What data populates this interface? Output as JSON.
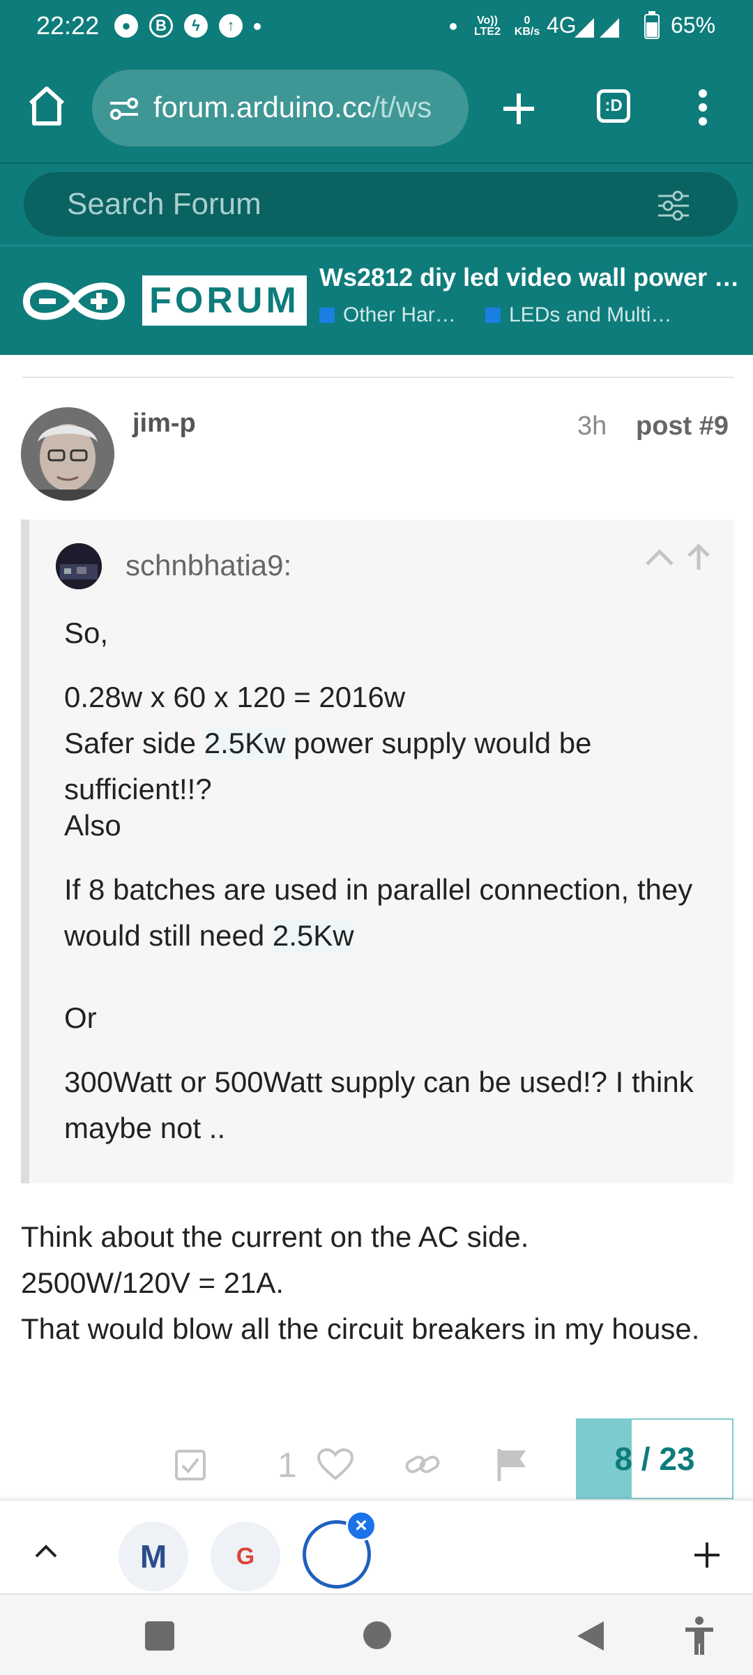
{
  "status_bar": {
    "time": "22:22",
    "notif_icons": [
      "chat-bubble-icon",
      "b-icon",
      "messenger-icon",
      "upload-icon"
    ],
    "net_label_1": "Vo))",
    "net_label_2": "LTE2",
    "speed_value": "0",
    "speed_unit": "KB/s",
    "network": "4G",
    "battery": "65%"
  },
  "browser": {
    "url_host": "forum.arduino.cc",
    "url_path": "/t/ws",
    "tab_switch_label": ":D"
  },
  "search": {
    "placeholder": "Search Forum"
  },
  "forum_header": {
    "forum_label": "FORUM",
    "topic_title": "Ws2812 diy led video wall power …",
    "categories": [
      "Other Har…",
      "LEDs and Multi…"
    ],
    "category_color": "#1a7fe0"
  },
  "post": {
    "username": "jim-p",
    "time_ago": "3h",
    "post_number": "post #9",
    "quote": {
      "author": "schnbhatia9:",
      "p1": "So,",
      "p2_line1": "0.28w x 60 x 120 = 2016w",
      "p2_line2_a": "Safer side ",
      "p2_line2_b": "2.5Kw",
      "p2_line2_c": " power supply would be sufficient!!?",
      "p3": "Also",
      "p4_a": "If 8 batches are used in parallel connection, they would still need ",
      "p4_b": "2.5Kw",
      "p5": "Or",
      "p6": "300Watt or 500Watt supply can be used!? I think maybe not .."
    },
    "body_line1": "Think about the current on the AC side.",
    "body_line2": "2500W/120V = 21A.",
    "body_line3": "That would blow all the circuit breakers in my house.",
    "like_count": "1"
  },
  "progress": {
    "current": "8",
    "separator": " / ",
    "total": "23",
    "fraction": 0.35
  },
  "tab_bar": {
    "tab1_letter": "M",
    "tab2_letter": "G"
  },
  "colors": {
    "brand_teal": "#0e7c7b",
    "progress_fill": "#7ccbcf",
    "tab_active_ring": "#1f5fbf",
    "close_badge": "#1a73e8"
  }
}
